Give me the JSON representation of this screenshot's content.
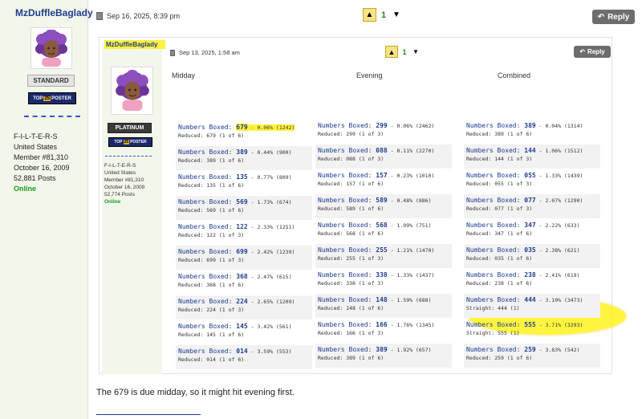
{
  "post": {
    "username": "MzDuffleBaglady",
    "date": "Sep 16, 2025, 8:39 pm",
    "rank": "STANDARD",
    "badge_left": "TOP",
    "badge_mid": "25",
    "badge_right": "POSTER",
    "location": "F-I-L-T-E-R-S",
    "country": "United States",
    "member": "Member #81,310",
    "joined": "October 16, 2009",
    "posts": "52,881 Posts",
    "status": "Online",
    "votes": "1",
    "reply_label": "Reply",
    "message": "The 679 is due midday, so it might hit evening first."
  },
  "quote": {
    "username": "MzDuffleBaglady",
    "date": "Sep 13, 2025, 1:58 am",
    "rank": "PLATINUM",
    "badge_left": "TOP",
    "badge_mid": "25",
    "badge_right": "POSTER",
    "location": "F-I-L-T-E-R-S",
    "country": "United States",
    "member": "Member #81,310",
    "joined": "October 16, 2009",
    "posts": "52,774 Posts",
    "status": "Online",
    "votes": "1",
    "reply_label": "Reply",
    "columns": [
      "Midday",
      "Evening",
      "Combined"
    ],
    "label": "Numbers Boxed:",
    "rows": [
      [
        {
          "num": "679",
          "pct": " - 0.06% (1242)",
          "sub": "Reduced: 679 (1 of 6)",
          "hl": true
        },
        {
          "num": "299",
          "pct": " - 0.06% (2462)",
          "sub": "Reduced: 299 (1 of 3)"
        },
        {
          "num": "389",
          "pct": " - 0.04% (1314)",
          "sub": "Reduced: 389 (1 of 6)"
        }
      ],
      [
        {
          "num": "389",
          "pct": " - 0.44% (900)",
          "sub": "Reduced: 389 (1 of 6)"
        },
        {
          "num": "088",
          "pct": " - 0.11% (2270)",
          "sub": "Reduced: 088 (1 of 3)"
        },
        {
          "num": "144",
          "pct": " - 1.06% (1512)",
          "sub": "Reduced: 144 (1 of 3)"
        }
      ],
      [
        {
          "num": "135",
          "pct": " - 0.77% (809)",
          "sub": "Reduced: 135 (1 of 6)"
        },
        {
          "num": "157",
          "pct": " - 0.23% (1010)",
          "sub": "Reduced: 157 (1 of 6)"
        },
        {
          "num": "055",
          "pct": " - 1.33% (1439)",
          "sub": "Reduced: 055 (1 of 3)"
        }
      ],
      [
        {
          "num": "569",
          "pct": " - 1.73% (674)",
          "sub": "Reduced: 569 (1 of 6)"
        },
        {
          "num": "589",
          "pct": " - 0.48% (886)",
          "sub": "Reduced: 589 (1 of 6)"
        },
        {
          "num": "077",
          "pct": " - 2.07% (1290)",
          "sub": "Reduced: 077 (1 of 3)"
        }
      ],
      [
        {
          "num": "122",
          "pct": " - 2.33% (1251)",
          "sub": "Reduced: 122 (1 of 3)"
        },
        {
          "num": "568",
          "pct": " - 1.09% (751)",
          "sub": "Reduced: 568 (1 of 6)"
        },
        {
          "num": "347",
          "pct": " - 2.22% (633)",
          "sub": "Reduced: 347 (1 of 6)"
        }
      ],
      [
        {
          "num": "699",
          "pct": " - 2.42% (1239)",
          "sub": "Reduced: 699 (1 of 3)"
        },
        {
          "num": "255",
          "pct": " - 1.21% (1470)",
          "sub": "Reduced: 255 (1 of 3)"
        },
        {
          "num": "035",
          "pct": " - 2.38% (621)",
          "sub": "Reduced: 035 (1 of 6)"
        }
      ],
      [
        {
          "num": "368",
          "pct": " - 2.47% (615)",
          "sub": "Reduced: 368 (1 of 6)"
        },
        {
          "num": "338",
          "pct": " - 1.33% (1437)",
          "sub": "Reduced: 338 (1 of 3)"
        },
        {
          "num": "238",
          "pct": " - 2.41% (619)",
          "sub": "Reduced: 238 (1 of 6)",
          "circled": true
        }
      ],
      [
        {
          "num": "224",
          "pct": " - 2.65% (1209)",
          "sub": "Reduced: 224 (1 of 3)"
        },
        {
          "num": "148",
          "pct": " - 1.59% (688)",
          "sub": "Reduced: 148 (1 of 6)"
        },
        {
          "num": "444",
          "pct": " - 3.10% (3473)",
          "sub": "Straight: 444 (1)"
        }
      ],
      [
        {
          "num": "145",
          "pct": " - 3.42% (561)",
          "sub": "Reduced: 145 (1 of 6)"
        },
        {
          "num": "166",
          "pct": " - 1.76% (1345)",
          "sub": "Reduced: 166 (1 of 3)"
        },
        {
          "num": "555",
          "pct": " - 3.71% (3293)",
          "sub": "Straight: 555 (1)"
        }
      ],
      [
        {
          "num": "014",
          "pct": " - 3.59% (553)",
          "sub": "Reduced: 014 (1 of 6)"
        },
        {
          "num": "389",
          "pct": " - 1.92% (657)",
          "sub": "Reduced: 389 (1 of 6)"
        },
        {
          "num": "259",
          "pct": " - 3.83% (542)",
          "sub": "Reduced: 259 (1 of 6)"
        }
      ]
    ]
  },
  "colors": {
    "link": "#1e3d8f",
    "highlight": "#fff33a",
    "online": "#1a9a1a",
    "vote_count": "#1f8a1f"
  }
}
